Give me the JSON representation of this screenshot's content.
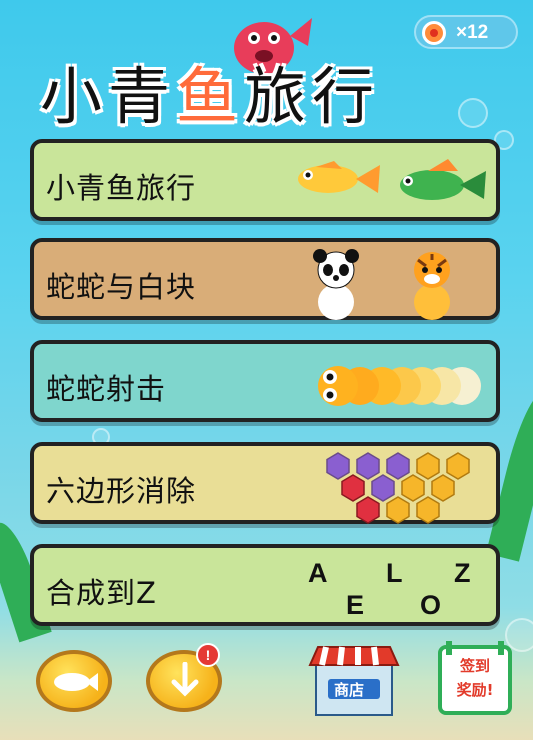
{
  "game": {
    "title": "小青鱼旅行",
    "title_parts": [
      "小青",
      "鱼",
      "旅行"
    ],
    "coin_count": "×12"
  },
  "menu": [
    {
      "label": "小青鱼旅行"
    },
    {
      "label": "蛇蛇与白块"
    },
    {
      "label": "蛇蛇射击"
    },
    {
      "label": "六边形消除"
    },
    {
      "label": "合成到Z"
    }
  ],
  "merge_letters": [
    "A",
    "L",
    "Z",
    "E",
    "O"
  ],
  "bottom": {
    "shop_label": "商店",
    "signin_line1": "签到",
    "signin_line2": "奖励!",
    "notice_mark": "!"
  },
  "colors": {
    "card_green": "#c9e59a",
    "card_tan": "#d9ad78",
    "card_teal": "#7fd6cd",
    "card_yellow": "#e9de96",
    "accent_orange": "#ff6b3a"
  }
}
